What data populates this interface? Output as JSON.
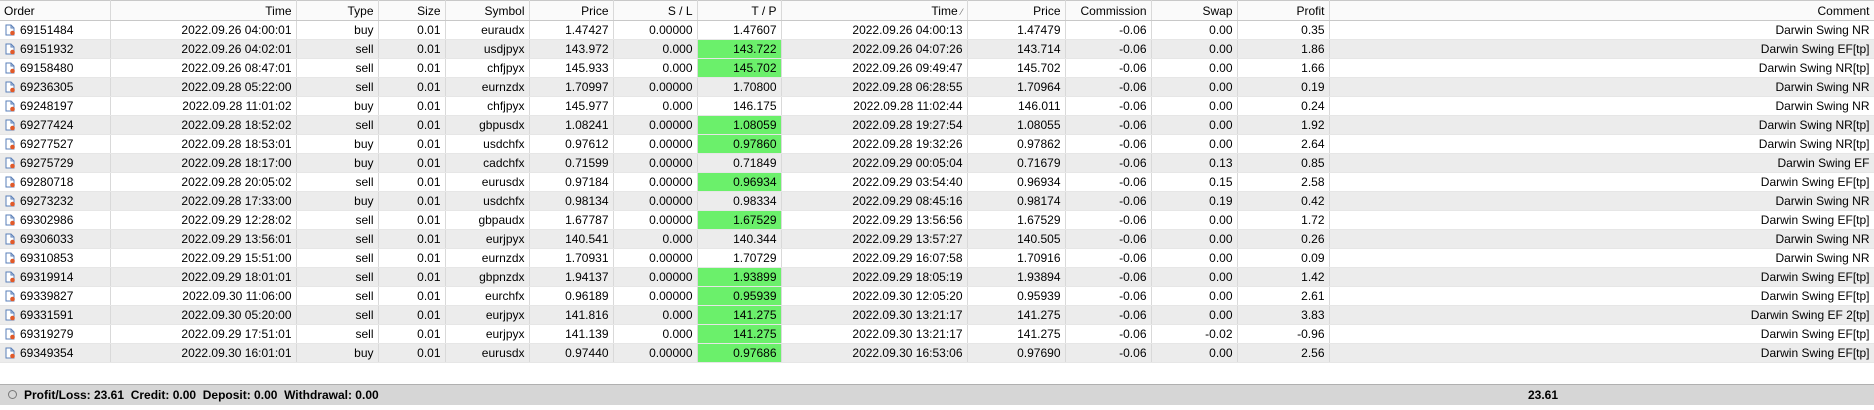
{
  "columns": [
    "Order",
    "Time",
    "Type",
    "Size",
    "Symbol",
    "Price",
    "S / L",
    "T / P",
    "Time",
    "Price",
    "Commission",
    "Swap",
    "Profit",
    "Comment"
  ],
  "sort_indicator": "⁄",
  "rows": [
    {
      "order": "69151484",
      "time": "2022.09.26 04:00:01",
      "type": "buy",
      "size": "0.01",
      "symbol": "euraudx",
      "price": "1.47427",
      "sl": "0.00000",
      "tp": "1.47607",
      "tp_hit": false,
      "close_time": "2022.09.26 04:00:13",
      "close_price": "1.47479",
      "commission": "-0.06",
      "swap": "0.00",
      "profit": "0.35",
      "comment": "Darwin Swing NR"
    },
    {
      "order": "69151932",
      "time": "2022.09.26 04:02:01",
      "type": "sell",
      "size": "0.01",
      "symbol": "usdjpyx",
      "price": "143.972",
      "sl": "0.000",
      "tp": "143.722",
      "tp_hit": true,
      "close_time": "2022.09.26 04:07:26",
      "close_price": "143.714",
      "commission": "-0.06",
      "swap": "0.00",
      "profit": "1.86",
      "comment": "Darwin Swing EF[tp]"
    },
    {
      "order": "69158480",
      "time": "2022.09.26 08:47:01",
      "type": "sell",
      "size": "0.01",
      "symbol": "chfjpyx",
      "price": "145.933",
      "sl": "0.000",
      "tp": "145.702",
      "tp_hit": true,
      "close_time": "2022.09.26 09:49:47",
      "close_price": "145.702",
      "commission": "-0.06",
      "swap": "0.00",
      "profit": "1.66",
      "comment": "Darwin Swing NR[tp]"
    },
    {
      "order": "69236305",
      "time": "2022.09.28 05:22:00",
      "type": "sell",
      "size": "0.01",
      "symbol": "eurnzdx",
      "price": "1.70997",
      "sl": "0.00000",
      "tp": "1.70800",
      "tp_hit": false,
      "close_time": "2022.09.28 06:28:55",
      "close_price": "1.70964",
      "commission": "-0.06",
      "swap": "0.00",
      "profit": "0.19",
      "comment": "Darwin Swing NR"
    },
    {
      "order": "69248197",
      "time": "2022.09.28 11:01:02",
      "type": "buy",
      "size": "0.01",
      "symbol": "chfjpyx",
      "price": "145.977",
      "sl": "0.000",
      "tp": "146.175",
      "tp_hit": false,
      "close_time": "2022.09.28 11:02:44",
      "close_price": "146.011",
      "commission": "-0.06",
      "swap": "0.00",
      "profit": "0.24",
      "comment": "Darwin Swing NR"
    },
    {
      "order": "69277424",
      "time": "2022.09.28 18:52:02",
      "type": "sell",
      "size": "0.01",
      "symbol": "gbpusdx",
      "price": "1.08241",
      "sl": "0.00000",
      "tp": "1.08059",
      "tp_hit": true,
      "close_time": "2022.09.28 19:27:54",
      "close_price": "1.08055",
      "commission": "-0.06",
      "swap": "0.00",
      "profit": "1.92",
      "comment": "Darwin Swing NR[tp]"
    },
    {
      "order": "69277527",
      "time": "2022.09.28 18:53:01",
      "type": "buy",
      "size": "0.01",
      "symbol": "usdchfx",
      "price": "0.97612",
      "sl": "0.00000",
      "tp": "0.97860",
      "tp_hit": true,
      "close_time": "2022.09.28 19:32:26",
      "close_price": "0.97862",
      "commission": "-0.06",
      "swap": "0.00",
      "profit": "2.64",
      "comment": "Darwin Swing NR[tp]"
    },
    {
      "order": "69275729",
      "time": "2022.09.28 18:17:00",
      "type": "buy",
      "size": "0.01",
      "symbol": "cadchfx",
      "price": "0.71599",
      "sl": "0.00000",
      "tp": "0.71849",
      "tp_hit": false,
      "close_time": "2022.09.29 00:05:04",
      "close_price": "0.71679",
      "commission": "-0.06",
      "swap": "0.13",
      "profit": "0.85",
      "comment": "Darwin Swing EF"
    },
    {
      "order": "69280718",
      "time": "2022.09.28 20:05:02",
      "type": "sell",
      "size": "0.01",
      "symbol": "eurusdx",
      "price": "0.97184",
      "sl": "0.00000",
      "tp": "0.96934",
      "tp_hit": true,
      "close_time": "2022.09.29 03:54:40",
      "close_price": "0.96934",
      "commission": "-0.06",
      "swap": "0.15",
      "profit": "2.58",
      "comment": "Darwin Swing EF[tp]"
    },
    {
      "order": "69273232",
      "time": "2022.09.28 17:33:00",
      "type": "buy",
      "size": "0.01",
      "symbol": "usdchfx",
      "price": "0.98134",
      "sl": "0.00000",
      "tp": "0.98334",
      "tp_hit": false,
      "close_time": "2022.09.29 08:45:16",
      "close_price": "0.98174",
      "commission": "-0.06",
      "swap": "0.19",
      "profit": "0.42",
      "comment": "Darwin Swing NR"
    },
    {
      "order": "69302986",
      "time": "2022.09.29 12:28:02",
      "type": "sell",
      "size": "0.01",
      "symbol": "gbpaudx",
      "price": "1.67787",
      "sl": "0.00000",
      "tp": "1.67529",
      "tp_hit": true,
      "close_time": "2022.09.29 13:56:56",
      "close_price": "1.67529",
      "commission": "-0.06",
      "swap": "0.00",
      "profit": "1.72",
      "comment": "Darwin Swing EF[tp]"
    },
    {
      "order": "69306033",
      "time": "2022.09.29 13:56:01",
      "type": "sell",
      "size": "0.01",
      "symbol": "eurjpyx",
      "price": "140.541",
      "sl": "0.000",
      "tp": "140.344",
      "tp_hit": false,
      "close_time": "2022.09.29 13:57:27",
      "close_price": "140.505",
      "commission": "-0.06",
      "swap": "0.00",
      "profit": "0.26",
      "comment": "Darwin Swing NR"
    },
    {
      "order": "69310853",
      "time": "2022.09.29 15:51:00",
      "type": "sell",
      "size": "0.01",
      "symbol": "eurnzdx",
      "price": "1.70931",
      "sl": "0.00000",
      "tp": "1.70729",
      "tp_hit": false,
      "close_time": "2022.09.29 16:07:58",
      "close_price": "1.70916",
      "commission": "-0.06",
      "swap": "0.00",
      "profit": "0.09",
      "comment": "Darwin Swing NR"
    },
    {
      "order": "69319914",
      "time": "2022.09.29 18:01:01",
      "type": "sell",
      "size": "0.01",
      "symbol": "gbpnzdx",
      "price": "1.94137",
      "sl": "0.00000",
      "tp": "1.93899",
      "tp_hit": true,
      "close_time": "2022.09.29 18:05:19",
      "close_price": "1.93894",
      "commission": "-0.06",
      "swap": "0.00",
      "profit": "1.42",
      "comment": "Darwin Swing EF[tp]"
    },
    {
      "order": "69339827",
      "time": "2022.09.30 11:06:00",
      "type": "sell",
      "size": "0.01",
      "symbol": "eurchfx",
      "price": "0.96189",
      "sl": "0.00000",
      "tp": "0.95939",
      "tp_hit": true,
      "close_time": "2022.09.30 12:05:20",
      "close_price": "0.95939",
      "commission": "-0.06",
      "swap": "0.00",
      "profit": "2.61",
      "comment": "Darwin Swing EF[tp]"
    },
    {
      "order": "69331591",
      "time": "2022.09.30 05:20:00",
      "type": "sell",
      "size": "0.01",
      "symbol": "eurjpyx",
      "price": "141.816",
      "sl": "0.000",
      "tp": "141.275",
      "tp_hit": true,
      "close_time": "2022.09.30 13:21:17",
      "close_price": "141.275",
      "commission": "-0.06",
      "swap": "0.00",
      "profit": "3.83",
      "comment": "Darwin Swing EF 2[tp]"
    },
    {
      "order": "69319279",
      "time": "2022.09.29 17:51:01",
      "type": "sell",
      "size": "0.01",
      "symbol": "eurjpyx",
      "price": "141.139",
      "sl": "0.000",
      "tp": "141.275",
      "tp_hit": true,
      "close_time": "2022.09.30 13:21:17",
      "close_price": "141.275",
      "commission": "-0.06",
      "swap": "-0.02",
      "profit": "-0.96",
      "comment": "Darwin Swing EF[tp]"
    },
    {
      "order": "69349354",
      "time": "2022.09.30 16:01:01",
      "type": "buy",
      "size": "0.01",
      "symbol": "eurusdx",
      "price": "0.97440",
      "sl": "0.00000",
      "tp": "0.97686",
      "tp_hit": true,
      "close_time": "2022.09.30 16:53:06",
      "close_price": "0.97690",
      "commission": "-0.06",
      "swap": "0.00",
      "profit": "2.56",
      "comment": "Darwin Swing EF[tp]"
    }
  ],
  "summary": {
    "text": "Profit/Loss: 23.61  Credit: 0.00  Deposit: 0.00  Withdrawal: 0.00",
    "profit_total": "23.61"
  },
  "colors": {
    "tp_hit": "#6bf06b",
    "row_alt": "#ececec",
    "summary_bg": "#d6d6d6"
  },
  "icons": {
    "order": "order-document-icon",
    "summary": "summary-circle-icon"
  }
}
